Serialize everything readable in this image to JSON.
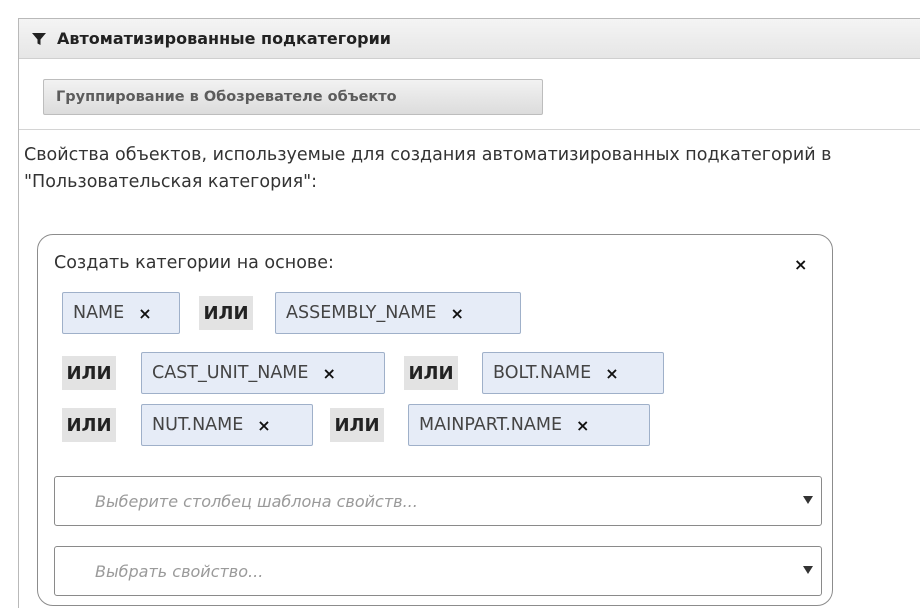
{
  "header": {
    "title": "Автоматизированные подкатегории",
    "icon": "filter-icon"
  },
  "toolbar": {
    "group_button_label": "Группирование в Обозревателе объекто"
  },
  "description": "Свойства объектов, используемые для создания автоматизированных подкатегорий в \"Пользовательская категория\":",
  "criteria": {
    "title": "Создать категории на основе:",
    "close_icon": "close-icon",
    "tags": [
      "NAME",
      "ASSEMBLY_NAME",
      "CAST_UNIT_NAME",
      "BOLT.NAME",
      "NUT.NAME",
      "MAINPART.NAME"
    ],
    "or_label": "ИЛИ",
    "remove_symbol": "×",
    "column_select": {
      "placeholder": "Выберите столбец шаблона свойств..."
    },
    "property_select": {
      "placeholder": "Выбрать свойство..."
    }
  },
  "colors": {
    "tag_bg": "#e6ecf7",
    "tag_border": "#9fb0c9",
    "or_bg": "#e3e3e3",
    "header_bg": "#ececec"
  }
}
